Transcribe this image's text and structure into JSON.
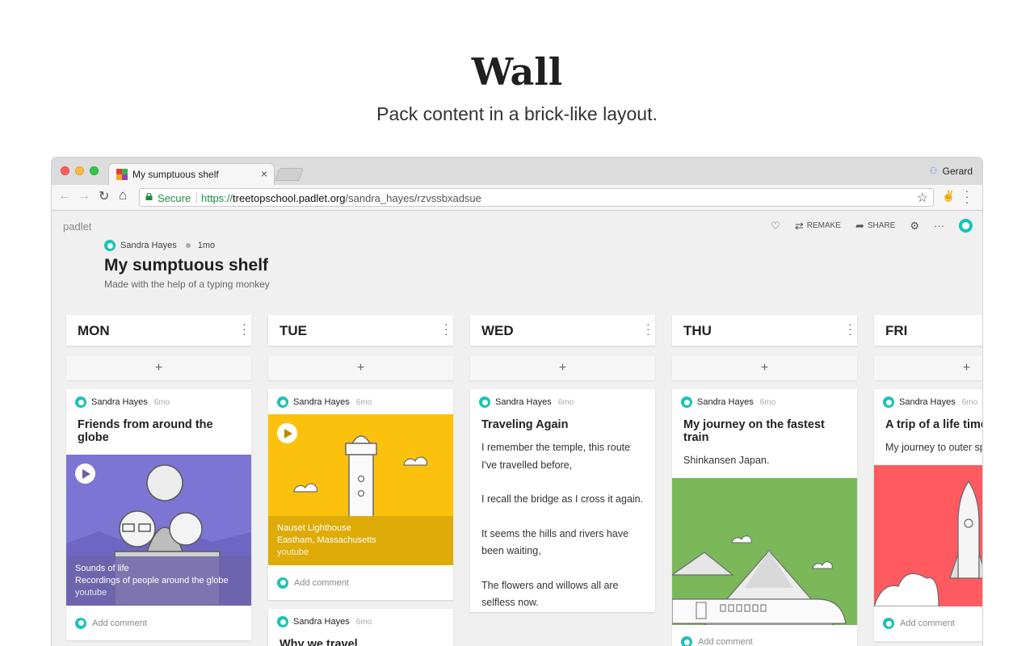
{
  "hero": {
    "title": "Wall",
    "subtitle": "Pack content in a brick-like layout."
  },
  "browser": {
    "tab_title": "My sumptuous shelf",
    "tab_close": "×",
    "profile_name": "Gerard",
    "secure_label": "Secure",
    "url_scheme": "https://",
    "url_host": "treetopschool.padlet.org",
    "url_path": "/sandra_hayes/rzvssbxadsue"
  },
  "padlet": {
    "brand": "padlet",
    "actions": {
      "remake": "REMAKE",
      "share": "SHARE"
    },
    "author": "Sandra Hayes",
    "age": "1mo",
    "title": "My sumptuous shelf",
    "description": "Made with the help of a typing monkey"
  },
  "add_symbol": "+",
  "columns": [
    {
      "name": "MON",
      "cards": [
        {
          "author": "Sandra Hayes",
          "time": "6mo",
          "title": "Friends from around the globe",
          "media": {
            "title": "Sounds of life",
            "subtitle": "Recordings of people around the globe",
            "source": "youtube"
          },
          "comment": "Add comment"
        }
      ]
    },
    {
      "name": "TUE",
      "cards": [
        {
          "author": "Sandra Hayes",
          "time": "6mo",
          "media": {
            "title": "Nauset Lighthouse",
            "subtitle": "Eastham, Massachusetts",
            "source": "youtube"
          },
          "comment": "Add comment"
        },
        {
          "author": "Sandra Hayes",
          "time": "6mo",
          "title": "Why we travel"
        }
      ]
    },
    {
      "name": "WED",
      "cards": [
        {
          "author": "Sandra Hayes",
          "time": "6mo",
          "title": "Traveling Again",
          "body": [
            "I remember the temple, this route I've travelled before,",
            "I recall the bridge as I cross it again.",
            "It seems the hills and rivers have been waiting,",
            "The flowers and willows all are selfless now."
          ]
        }
      ]
    },
    {
      "name": "THU",
      "cards": [
        {
          "author": "Sandra Hayes",
          "time": "6mo",
          "title": "My journey on the fastest train",
          "body": [
            "Shinkansen Japan."
          ],
          "comment": "Add comment"
        }
      ]
    },
    {
      "name": "FRI",
      "cards": [
        {
          "author": "Sandra Hayes",
          "time": "6mo",
          "title": "A trip of a life time",
          "body": [
            "My journey to outer space"
          ],
          "comment": "Add comment"
        }
      ]
    }
  ],
  "colors": {
    "accent_teal": "#19c3b5",
    "purple_media": "#7d74d4",
    "yellow_media": "#fcc10c",
    "green_media": "#7ab85a",
    "red_media": "#ff5a5f"
  }
}
